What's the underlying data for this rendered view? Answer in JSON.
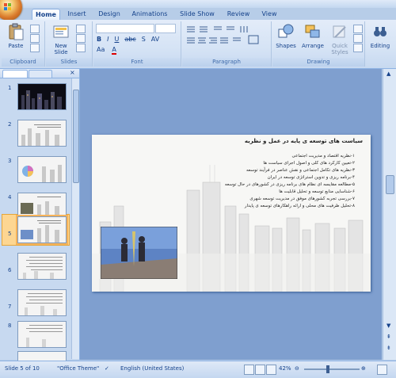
{
  "title_bar": {
    "text": ""
  },
  "tabs": [
    {
      "label": "Home",
      "active": true
    },
    {
      "label": "Insert",
      "active": false
    },
    {
      "label": "Design",
      "active": false
    },
    {
      "label": "Animations",
      "active": false
    },
    {
      "label": "Slide Show",
      "active": false
    },
    {
      "label": "Review",
      "active": false
    },
    {
      "label": "View",
      "active": false
    }
  ],
  "ribbon": {
    "clipboard": {
      "label": "Clipboard",
      "paste": "Paste"
    },
    "slides": {
      "label": "Slides",
      "new_slide_line1": "New",
      "new_slide_line2": "Slide"
    },
    "font": {
      "label": "Font",
      "font_name": "",
      "font_size": ""
    },
    "paragraph": {
      "label": "Paragraph"
    },
    "drawing": {
      "label": "Drawing",
      "shapes": "Shapes",
      "arrange": "Arrange",
      "quick_styles_line1": "Quick",
      "quick_styles_line2": "Styles"
    },
    "editing": {
      "label": "Editing"
    }
  },
  "slide_pane": {
    "numbers": [
      "1",
      "2",
      "3",
      "4",
      "5",
      "6",
      "7",
      "8"
    ],
    "selected_index": 4
  },
  "slide": {
    "title": "سیاست های توسعه ی پایه در عمل و نظریه",
    "bullets": [
      "۱-نظریه اقتصاد و مدیریت اجتماعی",
      "۲-تعیین کارکرد های کلی و اصول اجرای سیاست ها",
      "۳-نظریه های تکامل اجتماعی و نقش عناصر در فرآیند توسعه",
      "۴-برنامه ریزی و تدوین استراتژی توسعه در ایران",
      "۵-مطالعه مقایسه ای نظام های برنامه ریزی در کشورهای در حال توسعه",
      "۶-شناسایی منابع توسعه و تحلیل قابلیت ها",
      "۷-بررسی تجربه کشورهای موفق در مدیریت توسعه شهری",
      "۸-تحلیل ظرفیت های محلی و ارائه راهکارهای توسعه ی پایدار"
    ]
  },
  "status_bar": {
    "slide_info": "Slide 5 of 10",
    "theme": "\"Office Theme\"",
    "language": "English (United States)",
    "zoom": "42%"
  },
  "colors": {
    "accent": "#15428b",
    "ribbon": "#d5e3f5",
    "selected_thumb": "#fdd692"
  }
}
